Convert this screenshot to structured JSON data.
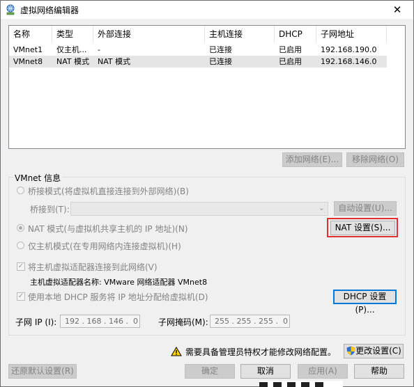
{
  "window": {
    "title": "虚拟网络编辑器",
    "close_glyph": "✕"
  },
  "network_list": {
    "headers": [
      "名称",
      "类型",
      "外部连接",
      "主机连接",
      "DHCP",
      "子网地址"
    ],
    "rows": [
      [
        "VMnet1",
        "仅主机...",
        "-",
        "已连接",
        "已启用",
        "192.168.190.0"
      ],
      [
        "VMnet8",
        "NAT 模式",
        "NAT 模式",
        "已连接",
        "已启用",
        "192.168.146.0"
      ]
    ],
    "selected_row": 1
  },
  "list_buttons": {
    "add": "添加网络(E)...",
    "remove": "移除网络(O)"
  },
  "vmnet_info": {
    "group_label": "VMnet 信息",
    "bridge_radio": "桥接模式(将虚拟机直接连接到外部网络)(B)",
    "bridge_to_label": "桥接到(T):",
    "bridge_to_value": "",
    "auto_settings": "自动设置(U)...",
    "nat_radio": "NAT 模式(与虚拟机共享主机的 IP 地址)(N)",
    "nat_settings": "NAT 设置(S)...",
    "hostonly_radio": "仅主机模式(在专用网络内连接虚拟机)(H)",
    "connect_adapter_check": "将主机虚拟适配器连接到此网络(V)",
    "adapter_name": "主机虚拟适配器名称: VMware 网络适配器 VMnet8",
    "dhcp_check": "使用本地 DHCP 服务将 IP 地址分配给虚拟机(D)",
    "dhcp_settings": "DHCP 设置(P)...",
    "subnet_ip_label": "子网 IP (I):",
    "subnet_ip_value": "192 . 168 . 146 .  0",
    "subnet_mask_label": "子网掩码(M):",
    "subnet_mask_value": "255 . 255 . 255 .  0",
    "selected_mode": "nat",
    "connect_adapter_checked": true,
    "dhcp_checked": true
  },
  "admin_notice": {
    "text": "需要具备管理员特权才能修改网络配置。",
    "change_settings": "更改设置(C)"
  },
  "footer": {
    "restore_defaults": "还原默认设置(R)",
    "ok": "确定",
    "cancel": "取消",
    "apply": "应用(A)",
    "help": "帮助"
  },
  "colors": {
    "highlight_box": "#e03131",
    "focus_border": "#0078d7"
  }
}
